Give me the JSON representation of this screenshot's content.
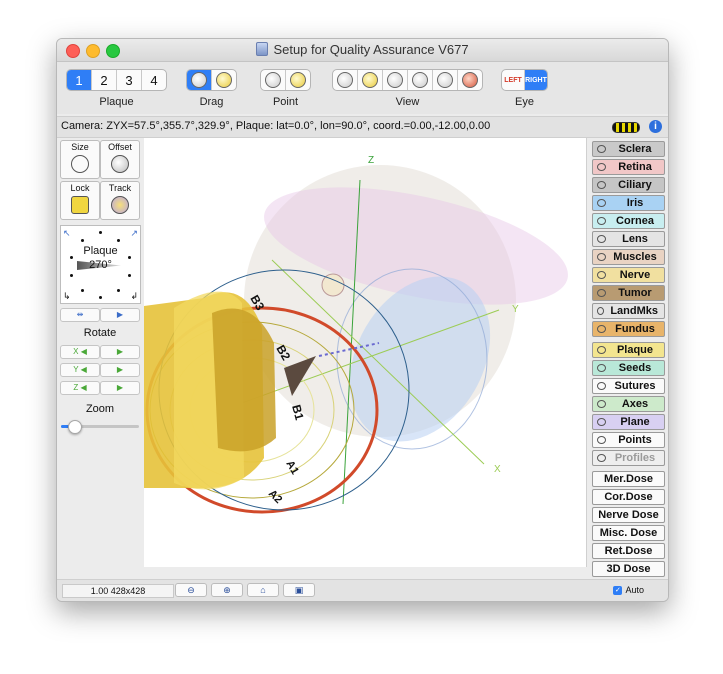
{
  "window": {
    "title": "Setup for Quality Assurance V677"
  },
  "toolbar": {
    "plaque_tabs": [
      "1",
      "2",
      "3",
      "4"
    ],
    "plaque_selected": "1",
    "plaque_label": "Plaque",
    "drag_label": "Drag",
    "point_label": "Point",
    "view_label": "View",
    "eye_label": "Eye",
    "eye_left": "LEFT",
    "eye_right": "RIGHT"
  },
  "status": {
    "camera_text": "Camera: ZYX=57.5°,355.7°,329.9°, Plaque: lat=0.0°, lon=90.0°, coord.=0.00,-12.00,0.00"
  },
  "left_panel": {
    "size_label": "Size",
    "offset_label": "Offset",
    "lock_label": "Lock",
    "track_label": "Track",
    "plaque_label": "Plaque",
    "plaque_angle": "270°",
    "rotate_label": "Rotate",
    "rotate_axes": [
      "X",
      "Y",
      "Z"
    ],
    "zoom_label": "Zoom",
    "zoom_level": 0.17
  },
  "canvas": {
    "axis_z": "Z",
    "axis_y": "Y",
    "axis_x": "X",
    "labels": [
      "B3",
      "B2",
      "B1",
      "A1",
      "A2"
    ]
  },
  "layers": [
    {
      "label": "Sclera",
      "color": "#c9c9c9"
    },
    {
      "label": "Retina",
      "color": "#f1c7c7"
    },
    {
      "label": "Ciliary",
      "color": "#c5c5c5"
    },
    {
      "label": "Iris",
      "color": "#a9d2f3"
    },
    {
      "label": "Cornea",
      "color": "#c8eef0"
    },
    {
      "label": "Lens",
      "color": "#e4e4e4"
    },
    {
      "label": "Muscles",
      "color": "#e9d3c3"
    },
    {
      "label": "Nerve",
      "color": "#f1e0a0"
    },
    {
      "label": "Tumor",
      "color": "#b89b72"
    },
    {
      "label": "LandMks",
      "color": "#e4e4e4"
    },
    {
      "label": "Fundus",
      "color": "#e8b46a"
    },
    {
      "label": "Plaque",
      "color": "#f3e58f"
    },
    {
      "label": "Seeds",
      "color": "#b9e8d8"
    },
    {
      "label": "Sutures",
      "color": "#fafafa"
    },
    {
      "label": "Axes",
      "color": "#cdeacb"
    },
    {
      "label": "Plane",
      "color": "#d8d0f2"
    },
    {
      "label": "Points",
      "color": "#fafafa"
    },
    {
      "label": "Profiles",
      "color": "#eeeeee"
    }
  ],
  "dose_buttons": [
    "Mer.Dose",
    "Cor.Dose",
    "Nerve Dose",
    "Misc. Dose",
    "Ret.Dose",
    "3D Dose"
  ],
  "bottom": {
    "zoom_readout": "1.00 428x428",
    "auto_label": "Auto"
  }
}
